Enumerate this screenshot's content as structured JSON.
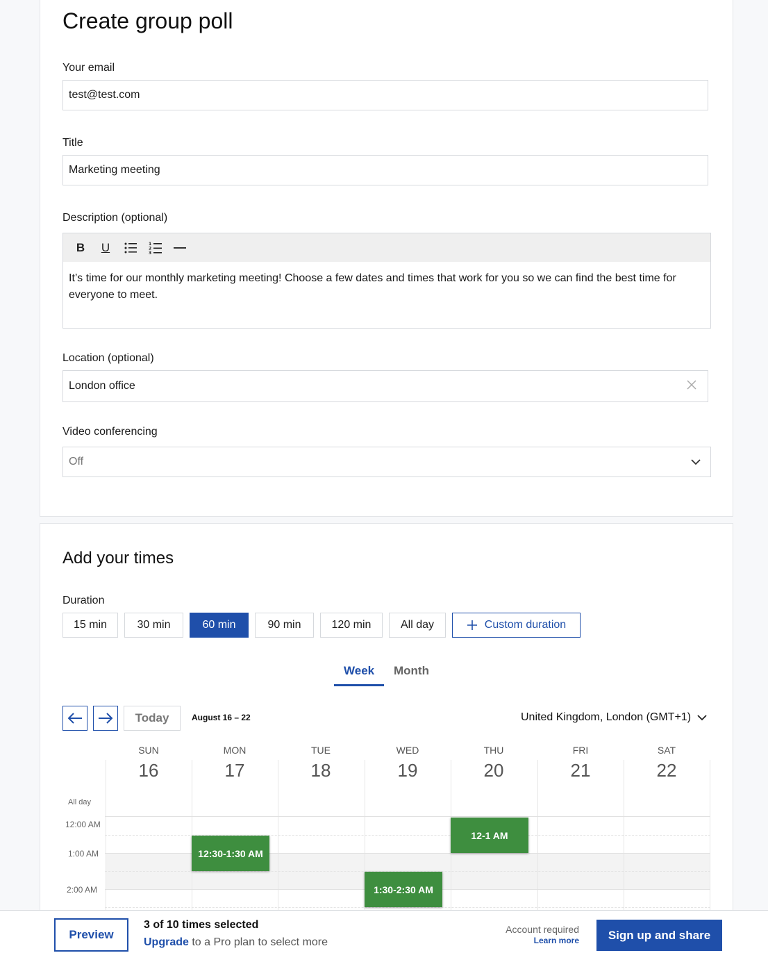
{
  "form": {
    "title": "Create group poll",
    "email": {
      "label": "Your email",
      "value": "test@test.com"
    },
    "poll_title": {
      "label": "Title",
      "value": "Marketing meeting"
    },
    "description": {
      "label": "Description (optional)",
      "value": "It’s time for our monthly marketing meeting! Choose a few dates and times that work for you so we can find the best time for everyone to meet.",
      "toolbar": {
        "bold": "B",
        "underline": "U"
      }
    },
    "location": {
      "label": "Location (optional)",
      "value": "London office"
    },
    "video": {
      "label": "Video conferencing",
      "value": "Off"
    }
  },
  "times": {
    "title": "Add your times",
    "duration_label": "Duration",
    "durations": [
      "15 min",
      "30 min",
      "60 min",
      "90 min",
      "120 min",
      "All day"
    ],
    "selected_duration": "60 min",
    "custom_duration": "Custom duration",
    "tabs": {
      "week": "Week",
      "month": "Month"
    },
    "active_tab": "Week",
    "today": "Today",
    "range": "August 16 – 22",
    "timezone": "United Kingdom, London (GMT+1)",
    "days": [
      {
        "name": "SUN",
        "num": "16"
      },
      {
        "name": "MON",
        "num": "17"
      },
      {
        "name": "TUE",
        "num": "18"
      },
      {
        "name": "WED",
        "num": "19"
      },
      {
        "name": "THU",
        "num": "20"
      },
      {
        "name": "FRI",
        "num": "21"
      },
      {
        "name": "SAT",
        "num": "22"
      }
    ],
    "all_day": "All day",
    "time_labels": [
      "12:00 AM",
      "1:00 AM",
      "2:00 AM"
    ],
    "events": [
      {
        "label": "12:30-1:30 AM",
        "day": "MON"
      },
      {
        "label": "12-1 AM",
        "day": "THU"
      },
      {
        "label": "1:30-2:30 AM",
        "day": "WED"
      }
    ]
  },
  "footer": {
    "preview": "Preview",
    "selected": "3 of 10 times selected",
    "upgrade": "Upgrade",
    "upgrade_rest": "to a Pro plan to select more",
    "account_required": "Account required",
    "learn_more": "Learn more",
    "signup": "Sign up and share"
  },
  "colors": {
    "accent": "#1f4faa",
    "event": "#3e8e3f"
  }
}
